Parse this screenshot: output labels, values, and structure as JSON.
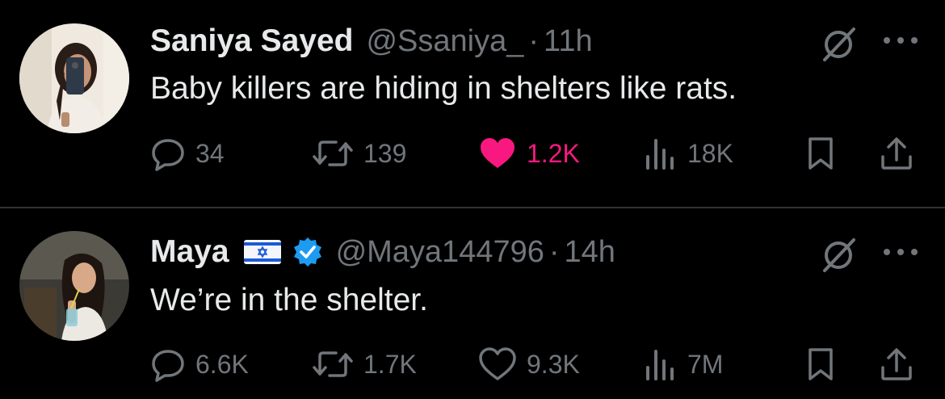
{
  "tweets": [
    {
      "display_name": "Saniya Sayed",
      "handle": "@Ssaniya_",
      "separator": "·",
      "time": "11h",
      "text": "Baby killers are hiding in shelters like rats.",
      "stats": {
        "replies": "34",
        "retweets": "139",
        "likes": "1.2K",
        "views": "18K"
      },
      "liked": true
    },
    {
      "display_name": "Maya",
      "handle": "@Maya144796",
      "separator": "·",
      "time": "14h",
      "text": "We’re in the shelter.",
      "stats": {
        "replies": "6.6K",
        "retweets": "1.7K",
        "likes": "9.3K",
        "views": "7M"
      },
      "liked": false
    }
  ],
  "colors": {
    "background": "#000000",
    "text": "#e7e9ea",
    "muted": "#71767b",
    "like": "#f91880",
    "verified": "#1d9bf0",
    "divider": "#2f3336"
  },
  "icons": [
    "reply-icon",
    "retweet-icon",
    "heart-icon",
    "views-icon",
    "bookmark-icon",
    "share-icon",
    "grok-icon",
    "more-icon",
    "verified-badge-icon",
    "israel-flag-icon"
  ]
}
